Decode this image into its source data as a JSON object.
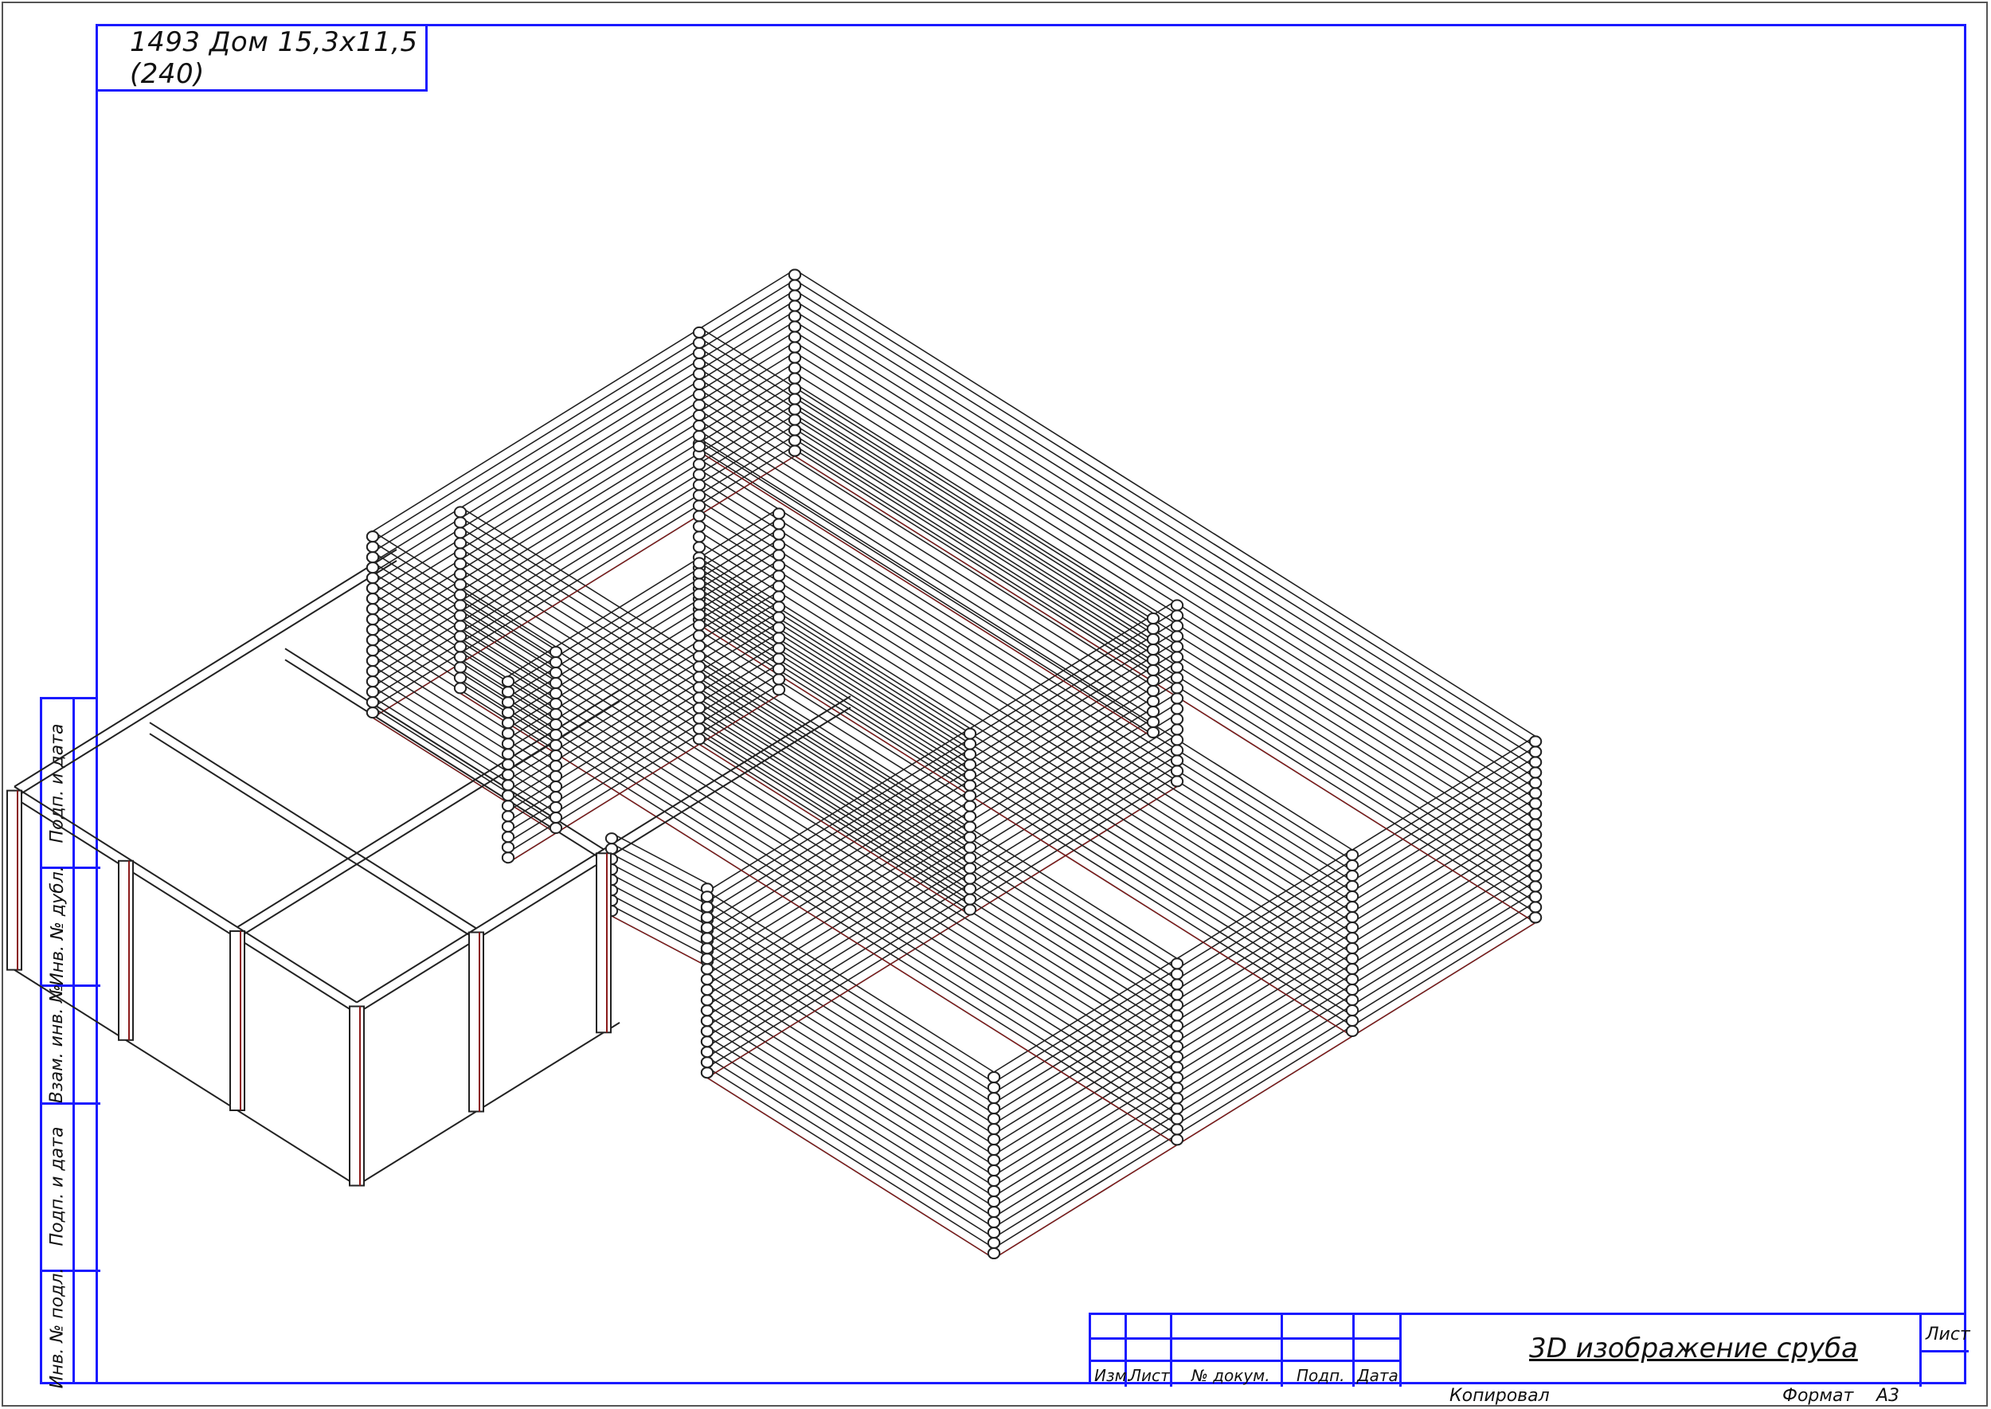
{
  "sheet_title": "1493 Дом 15,3х11,5 (240)",
  "side_stamp": [
    "Подп. и дата",
    "Инв. № дубл.",
    "Взам. инв. №",
    "Подп. и дата",
    "Инв. № подл."
  ],
  "stamp": {
    "headers": [
      "Изм.",
      "Лист",
      "№ докум.",
      "Подп.",
      "Дата"
    ],
    "drawing_title": "3D изображение сруба",
    "sheet_label": "Лист"
  },
  "footer": {
    "copied": "Копировал",
    "format_label": "Формат",
    "format_value": "А3"
  },
  "colors": {
    "frame": "#1a1aff",
    "lines": "#222222",
    "accent": "#8b1a1a"
  }
}
